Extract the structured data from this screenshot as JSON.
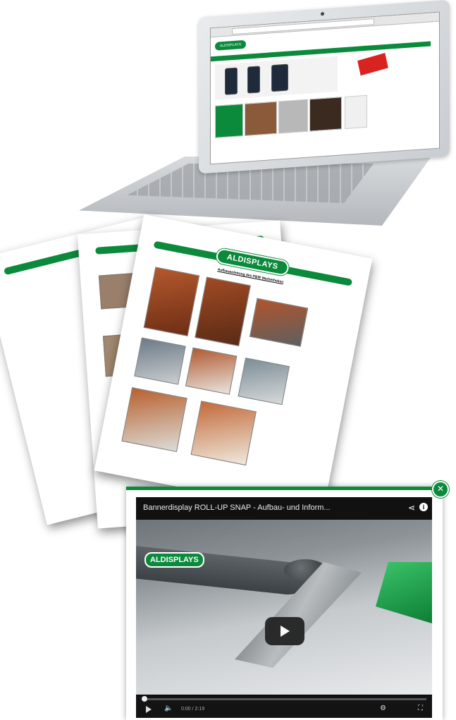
{
  "laptop": {
    "site_logo": "ALDISPLAYS"
  },
  "documents": {
    "logo": "ALDISPLAYS",
    "title": "Aufbauanleitung des PBW Werbetheken"
  },
  "video": {
    "title": "Bannerdisplay ROLL-UP SNAP - Aufbau- und Inform...",
    "brand": "ALDISPLAYS",
    "close_glyph": "✕",
    "share_glyph": "⋖",
    "info_glyph": "i",
    "volume_glyph": "🔈",
    "settings_glyph": "⚙",
    "fullscreen_glyph": "⛶",
    "time": "0:00 / 2:19",
    "progress": 0.0
  },
  "colors": {
    "brand_green": "#0b8a3c",
    "player_black": "#000000",
    "offer_red": "#d9231f"
  }
}
